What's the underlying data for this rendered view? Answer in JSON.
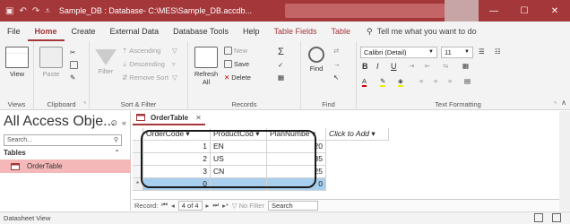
{
  "window": {
    "title": "Sample_DB : Database- C:\\MES\\Sample_DB.accdb...",
    "controls": {
      "minimize": "—",
      "restore": "☐",
      "close": "✕"
    }
  },
  "menu": {
    "tabs": [
      "File",
      "Home",
      "Create",
      "External Data",
      "Database Tools",
      "Help",
      "Table Fields",
      "Table"
    ],
    "active": "Home",
    "tell_me": "Tell me what you want to do"
  },
  "ribbon": {
    "views": {
      "view": "View",
      "label": "Views"
    },
    "clipboard": {
      "paste": "Paste",
      "label": "Clipboard"
    },
    "sort_filter": {
      "filter": "Filter",
      "ascending": "Ascending",
      "descending": "Descending",
      "remove_sort": "Remove Sort",
      "label": "Sort & Filter"
    },
    "records": {
      "refresh": "Refresh",
      "refresh_sub": "All",
      "new": "New",
      "save": "Save",
      "delete": "Delete",
      "label": "Records"
    },
    "find": {
      "find": "Find",
      "label": "Find"
    },
    "text_formatting": {
      "font": "Calibri (Detail)",
      "size": "11",
      "bold": "B",
      "italic": "I",
      "underline": "U",
      "label": "Text Formatting"
    }
  },
  "nav": {
    "title": "All Access Obje...",
    "search_placeholder": "Search...",
    "section": "Tables",
    "items": [
      "OrderTable"
    ]
  },
  "document": {
    "tab": "OrderTable",
    "columns": [
      "OrderCode",
      "ProductCod",
      "PlanNumbe",
      "Click to Add"
    ],
    "rows": [
      {
        "OrderCode": "1",
        "ProductCode": "EN",
        "PlanNumber": "20"
      },
      {
        "OrderCode": "2",
        "ProductCode": "US",
        "PlanNumber": "35"
      },
      {
        "OrderCode": "3",
        "ProductCode": "CN",
        "PlanNumber": "25"
      }
    ],
    "new_row": {
      "marker": "*",
      "OrderCode": "0",
      "PlanNumber": "0"
    },
    "record_nav": {
      "label": "Record:",
      "position": "4 of 4",
      "filter": "No Filter",
      "search": "Search"
    }
  },
  "status": {
    "text": "Datasheet View"
  },
  "colors": {
    "accent": "#a4373a",
    "selection": "#f4b8b8",
    "new_row": "#a9cfee"
  }
}
